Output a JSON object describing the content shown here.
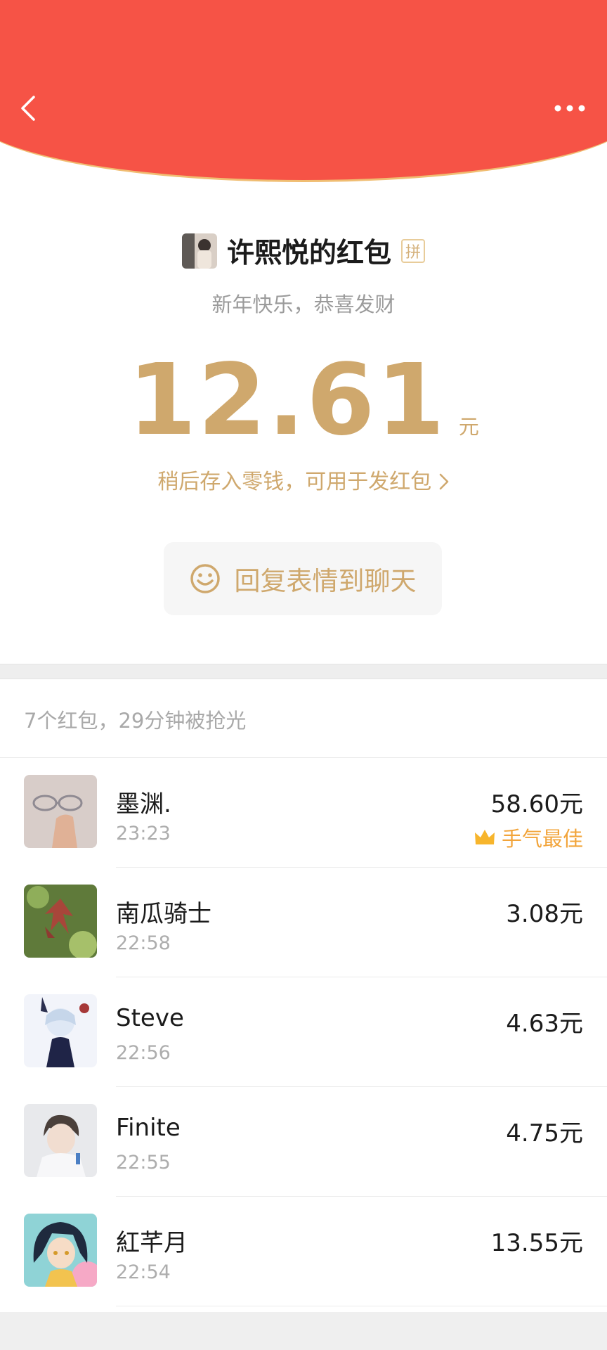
{
  "header": {
    "accent_color": "#f65346",
    "back_icon": "chevron-left-icon",
    "more_icon": "more-horizontal-icon"
  },
  "sender": {
    "title": "许熙悦的红包",
    "badge": "拼"
  },
  "greeting": "新年快乐，恭喜发财",
  "received": {
    "amount": "12.61",
    "unit": "元",
    "hint": "稍后存入零钱，可用于发红包",
    "hint_icon": "chevron-right-icon",
    "color": "#cfa86d"
  },
  "reply_button": {
    "icon": "smiley-icon",
    "label": "回复表情到聊天"
  },
  "summary": "7个红包，29分钟被抢光",
  "recipients": [
    {
      "name": "墨渊.",
      "time": "23:23",
      "amount": "58.60元",
      "best_label": "手气最佳",
      "best_icon": "crown-icon"
    },
    {
      "name": "南瓜骑士",
      "time": "22:58",
      "amount": "3.08元"
    },
    {
      "name": "Steve",
      "time": "22:56",
      "amount": "4.63元"
    },
    {
      "name": "Finite",
      "time": "22:55",
      "amount": "4.75元"
    },
    {
      "name": "紅芊月",
      "time": "22:54",
      "amount": "13.55元"
    }
  ]
}
